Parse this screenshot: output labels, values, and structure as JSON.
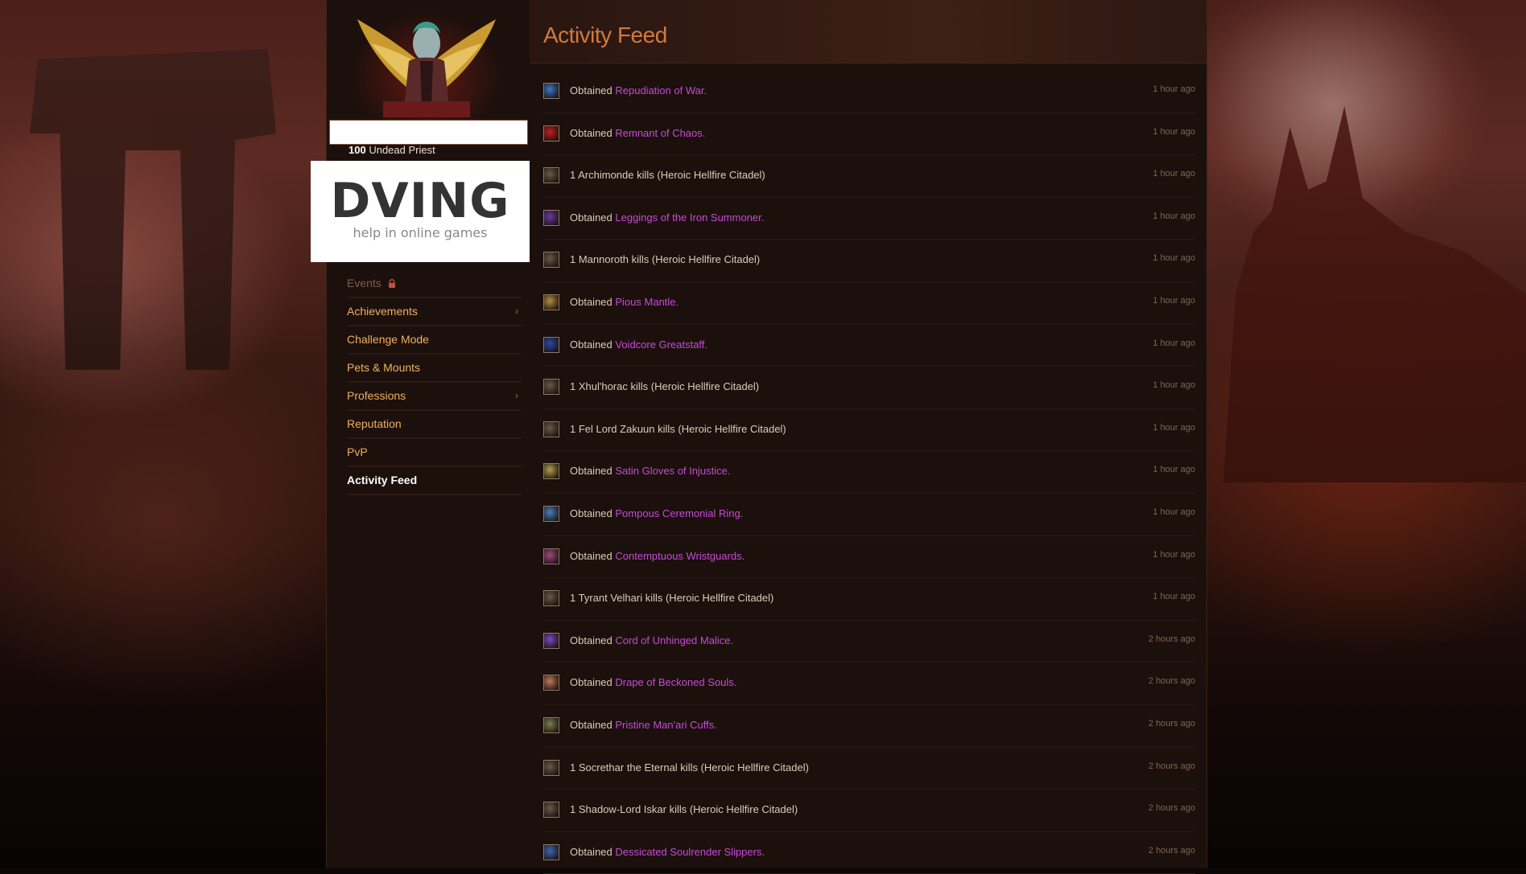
{
  "character": {
    "name": "",
    "level": "100",
    "race_class": "Undead Priest"
  },
  "watermark": {
    "brand": "DVING",
    "tagline": "help in online games"
  },
  "nav": {
    "items": [
      {
        "label": "Events",
        "state": "disabled",
        "icon": "lock-icon"
      },
      {
        "label": "Achievements",
        "state": "normal",
        "chevron": true
      },
      {
        "label": "Challenge Mode",
        "state": "normal"
      },
      {
        "label": "Pets & Mounts",
        "state": "normal"
      },
      {
        "label": "Professions",
        "state": "normal",
        "chevron": true
      },
      {
        "label": "Reputation",
        "state": "normal"
      },
      {
        "label": "PvP",
        "state": "normal"
      },
      {
        "label": "Activity Feed",
        "state": "active"
      }
    ]
  },
  "feed": {
    "title": "Activity Feed",
    "entries": [
      {
        "type": "loot",
        "prefix": "Obtained ",
        "item": "Repudiation of War",
        "suffix": ".",
        "time": "1 hour ago",
        "icon": "cloak-icon",
        "color": "#3a7ac8"
      },
      {
        "type": "loot",
        "prefix": "Obtained ",
        "item": "Remnant of Chaos",
        "suffix": ".",
        "time": "1 hour ago",
        "icon": "trinket-icon",
        "color": "#c02020"
      },
      {
        "type": "kill",
        "text": "1 Archimonde kills (Heroic Hellfire Citadel)",
        "time": "1 hour ago",
        "icon": "skull-icon",
        "color": "#6a5a4a"
      },
      {
        "type": "loot",
        "prefix": "Obtained ",
        "item": "Leggings of the Iron Summoner",
        "suffix": ".",
        "time": "1 hour ago",
        "icon": "legs-icon",
        "color": "#6a3aa0"
      },
      {
        "type": "kill",
        "text": "1 Mannoroth kills (Heroic Hellfire Citadel)",
        "time": "1 hour ago",
        "icon": "skull-icon",
        "color": "#6a5a4a"
      },
      {
        "type": "loot",
        "prefix": "Obtained ",
        "item": "Pious Mantle",
        "suffix": ".",
        "time": "1 hour ago",
        "icon": "shoulder-icon",
        "color": "#b09040"
      },
      {
        "type": "loot",
        "prefix": "Obtained ",
        "item": "Voidcore Greatstaff",
        "suffix": ".",
        "time": "1 hour ago",
        "icon": "staff-icon",
        "color": "#2a4aa8"
      },
      {
        "type": "kill",
        "text": "1 Xhul'horac kills (Heroic Hellfire Citadel)",
        "time": "1 hour ago",
        "icon": "skull-icon",
        "color": "#6a5a4a"
      },
      {
        "type": "kill",
        "text": "1 Fel Lord Zakuun kills (Heroic Hellfire Citadel)",
        "time": "1 hour ago",
        "icon": "skull-icon",
        "color": "#6a5a4a"
      },
      {
        "type": "loot",
        "prefix": "Obtained ",
        "item": "Satin Gloves of Injustice",
        "suffix": ".",
        "time": "1 hour ago",
        "icon": "gloves-icon",
        "color": "#b0a050"
      },
      {
        "type": "loot",
        "prefix": "Obtained ",
        "item": "Pompous Ceremonial Ring",
        "suffix": ".",
        "time": "1 hour ago",
        "icon": "ring-icon",
        "color": "#4a80c0"
      },
      {
        "type": "loot",
        "prefix": "Obtained ",
        "item": "Contemptuous Wristguards",
        "suffix": ".",
        "time": "1 hour ago",
        "icon": "bracers-icon",
        "color": "#a04a80"
      },
      {
        "type": "kill",
        "text": "1 Tyrant Velhari kills (Heroic Hellfire Citadel)",
        "time": "1 hour ago",
        "icon": "skull-icon",
        "color": "#6a5a4a"
      },
      {
        "type": "loot",
        "prefix": "Obtained ",
        "item": "Cord of Unhinged Malice",
        "suffix": ".",
        "time": "2 hours ago",
        "icon": "belt-icon",
        "color": "#7a4ac0"
      },
      {
        "type": "loot",
        "prefix": "Obtained ",
        "item": "Drape of Beckoned Souls",
        "suffix": ".",
        "time": "2 hours ago",
        "icon": "cloak-icon",
        "color": "#c07a5a"
      },
      {
        "type": "loot",
        "prefix": "Obtained ",
        "item": "Pristine Man'ari Cuffs",
        "suffix": ".",
        "time": "2 hours ago",
        "icon": "bracers-icon",
        "color": "#7a8050"
      },
      {
        "type": "kill",
        "text": "1 Socrethar the Eternal kills (Heroic Hellfire Citadel)",
        "time": "2 hours ago",
        "icon": "skull-icon",
        "color": "#6a5a4a"
      },
      {
        "type": "kill",
        "text": "1 Shadow-Lord Iskar kills (Heroic Hellfire Citadel)",
        "time": "2 hours ago",
        "icon": "skull-icon",
        "color": "#6a5a4a"
      },
      {
        "type": "loot",
        "prefix": "Obtained ",
        "item": "Dessicated Soulrender Slippers",
        "suffix": ".",
        "time": "2 hours ago",
        "icon": "boots-icon",
        "color": "#3a6ab0"
      }
    ]
  },
  "colors": {
    "accent": "#d27a3c",
    "nav_link": "#f0b060",
    "epic_item": "#c54ad8",
    "time_text": "#7d6553"
  }
}
